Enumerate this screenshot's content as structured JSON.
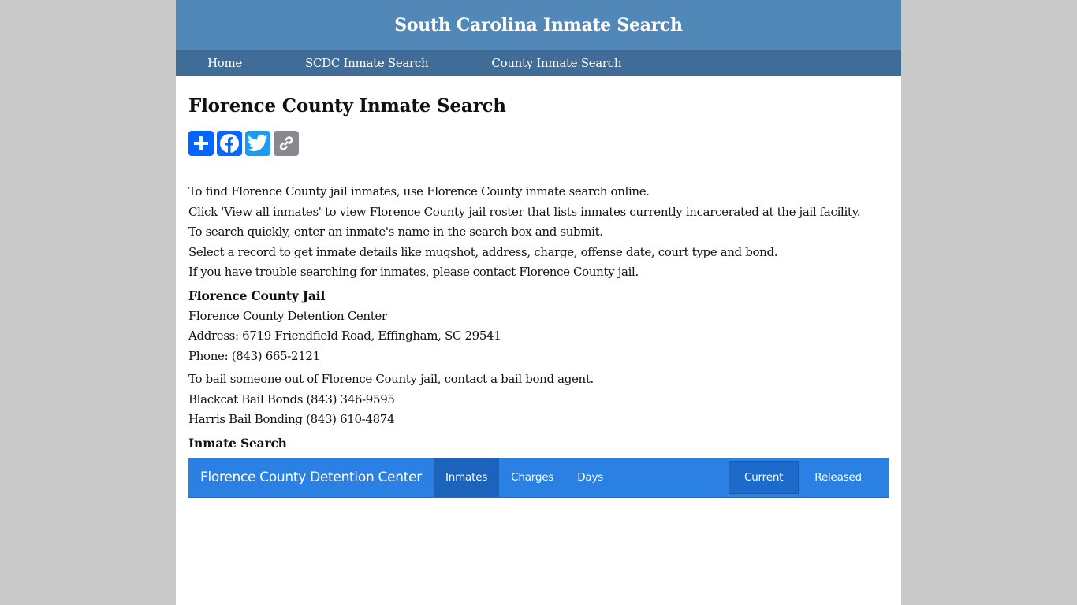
{
  "header": {
    "title": "South Carolina Inmate Search"
  },
  "nav": {
    "items": [
      {
        "label": "Home"
      },
      {
        "label": "SCDC Inmate Search"
      },
      {
        "label": "County Inmate Search"
      }
    ]
  },
  "page": {
    "title": "Florence County Inmate Search"
  },
  "share": {
    "buttons": [
      {
        "name": "add",
        "icon": "plus-icon",
        "color": "#0166ff"
      },
      {
        "name": "facebook",
        "icon": "facebook-icon",
        "color": "#0866ff"
      },
      {
        "name": "twitter",
        "icon": "twitter-icon",
        "color": "#1d9bf0"
      },
      {
        "name": "copy-link",
        "icon": "link-icon",
        "color": "#888990"
      }
    ]
  },
  "intro": [
    "To find Florence County jail inmates, use Florence County inmate search online.",
    "Click 'View all inmates' to view Florence County jail roster that lists inmates currently incarcerated at the jail facility.",
    "To search quickly, enter an inmate's name in the search box and submit.",
    "Select a record to get inmate details like mugshot, address, charge, offense date, court type and bond.",
    "If you have trouble searching for inmates, please contact Florence County jail."
  ],
  "jail": {
    "heading": "Florence County Jail",
    "name": "Florence County Detention Center",
    "address": "Address: 6719 Friendfield Road, Effingham, SC 29541",
    "phone": "Phone: (843) 665-2121"
  },
  "bail": {
    "intro": "To bail someone out of Florence County jail, contact a bail bond agent.",
    "agents": [
      "Blackcat Bail Bonds (843) 346-9595",
      "Harris Bail Bonding (843) 610-4874"
    ]
  },
  "inmate_search": {
    "heading": "Inmate Search",
    "brand": "Florence County Detention Center",
    "tabs": [
      {
        "label": "Inmates",
        "active": true
      },
      {
        "label": "Charges",
        "active": false
      },
      {
        "label": "Days",
        "active": false
      }
    ],
    "toggles": [
      {
        "label": "Current",
        "active": true
      },
      {
        "label": "Released",
        "active": false
      }
    ],
    "bar_color": "#2a80e3"
  }
}
